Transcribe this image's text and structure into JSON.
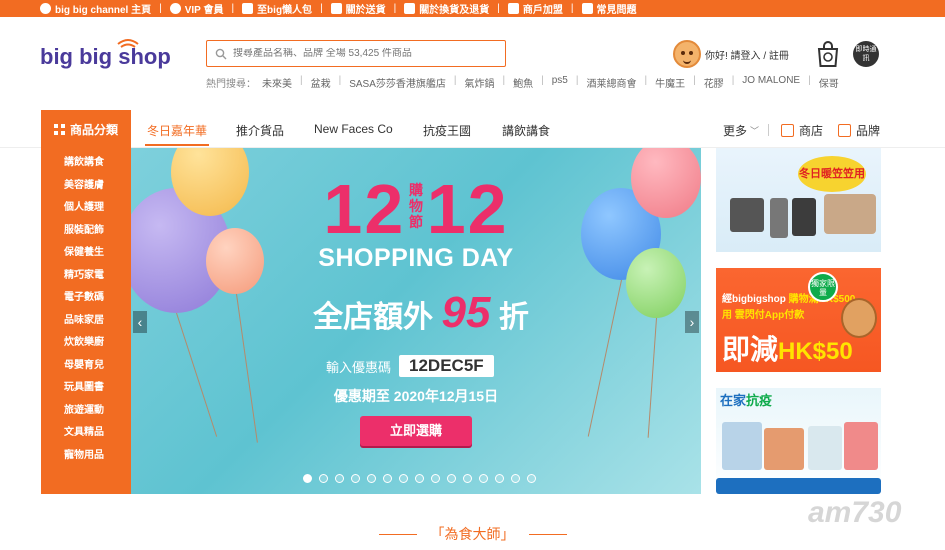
{
  "topbar": {
    "items": [
      {
        "label": "big big channel 主頁",
        "icon": "bbc-icon"
      },
      {
        "label": "VIP 會員",
        "icon": "vip-icon"
      },
      {
        "label": "至big懶人包",
        "icon": "gift-icon"
      },
      {
        "label": "關於送貨",
        "icon": "truck-icon"
      },
      {
        "label": "關於換貨及退貨",
        "icon": "return-icon"
      },
      {
        "label": "商戶加盟",
        "icon": "store-icon"
      },
      {
        "label": "常見問題",
        "icon": "question-icon"
      }
    ]
  },
  "header": {
    "logo_text": "big big shop",
    "search_placeholder": "搜尋產品名稱、品牌 全場 53,425 件商品",
    "hot_label": "熱門搜尋：",
    "hot_keywords": [
      "未來美",
      "盆栽",
      "SASA莎莎香港旗艦店",
      "氣炸鍋",
      "鮑魚",
      "ps5",
      "酒莱總商會",
      "牛魔王",
      "花膠",
      "JO MALONE",
      "保哥"
    ],
    "user_text": "你好! 請登入 / 註冊",
    "cs_label": "即時通訊"
  },
  "nav": {
    "category_label": "商品分類",
    "tabs": [
      "冬日嘉年華",
      "推介貨品",
      "New Faces Co",
      "抗疫王國",
      "講飲講食"
    ],
    "active_tab": 0,
    "more_label": "更多",
    "shop_label": "商店",
    "brand_label": "品牌"
  },
  "categories": [
    "講飲講食",
    "美容護膚",
    "個人護理",
    "服裝配飾",
    "保健養生",
    "精巧家電",
    "電子數碼",
    "品味家居",
    "炊飲樂廚",
    "母嬰育兒",
    "玩具圖書",
    "旅遊運動",
    "文具精品",
    "寵物用品"
  ],
  "banner": {
    "big_title": "12  12",
    "vertical_text": "購物節",
    "subtitle": "SHOPPING DAY",
    "discount_prefix": "全店額外",
    "discount_value": "95",
    "discount_suffix": "折",
    "code_label": "輸入優惠碼",
    "code": "12DEC5F",
    "date_text": "優惠期至 2020年12月15日",
    "button_label": "立即選購",
    "slide_count": 15,
    "active_slide": 0
  },
  "promos": {
    "tile1_badge": "冬日暖笠笠用品",
    "tile2_line1_a": "經bigbigshop",
    "tile2_line1_b": "購物滿HK$500",
    "tile2_line2": "用 雲閃付App付款",
    "tile2_line3_a": "即減",
    "tile2_line3_b": "HK$50",
    "tile2_pill": "獨家限量",
    "tile3_title_a": "在家",
    "tile3_title_b": "抗疫"
  },
  "section_heading": "「為食大師」",
  "watermark": "am730",
  "colors": {
    "brand_orange": "#f26c22",
    "banner_pink": "#ec2f6a",
    "banner_teal": "#5ec3d1"
  }
}
